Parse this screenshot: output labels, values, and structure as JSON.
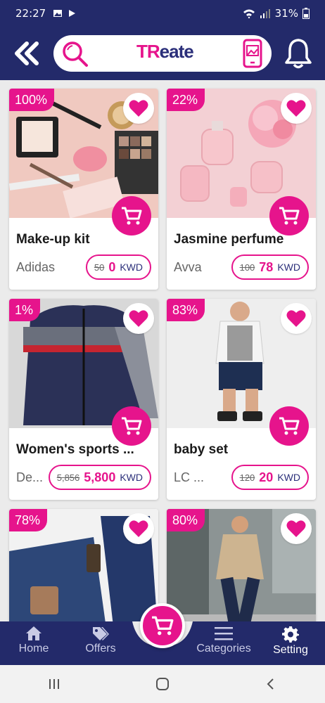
{
  "status_bar": {
    "time": "22:27",
    "battery": "31%"
  },
  "header": {
    "logo_left": "TR",
    "logo_right": "eate"
  },
  "products": [
    {
      "badge": "100%",
      "name": "Make-up kit",
      "brand": "Adidas",
      "old_price": "50",
      "new_price": "0",
      "currency": "KWD"
    },
    {
      "badge": "22%",
      "name": "Jasmine perfume",
      "brand": "Avva",
      "old_price": "100",
      "new_price": "78",
      "currency": "KWD"
    },
    {
      "badge": "1%",
      "name": "Women's sports ...",
      "brand": "De...",
      "old_price": "5,856",
      "new_price": "5,800",
      "currency": "KWD"
    },
    {
      "badge": "83%",
      "name": "baby set",
      "brand": "LC ...",
      "old_price": "120",
      "new_price": "20",
      "currency": "KWD"
    },
    {
      "badge": "78%",
      "name": "",
      "brand": "",
      "old_price": "",
      "new_price": "",
      "currency": ""
    },
    {
      "badge": "80%",
      "name": "",
      "brand": "",
      "old_price": "",
      "new_price": "",
      "currency": ""
    }
  ],
  "bottom_nav": [
    {
      "label": "Home",
      "icon": "home-icon"
    },
    {
      "label": "Offers",
      "icon": "tags-icon"
    },
    {
      "label": "Categories",
      "icon": "menu-icon"
    },
    {
      "label": "Setting",
      "icon": "gear-icon"
    }
  ],
  "colors": {
    "primary": "#232a6a",
    "accent": "#e6148c"
  }
}
